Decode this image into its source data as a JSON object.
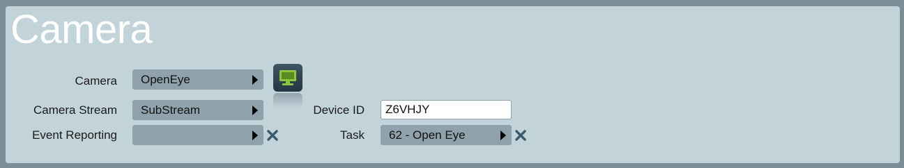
{
  "page": {
    "title": "Camera"
  },
  "form": {
    "camera": {
      "label": "Camera",
      "value": "OpenEye"
    },
    "camera_stream": {
      "label": "Camera Stream",
      "value": "SubStream"
    },
    "event_reporting": {
      "label": "Event Reporting",
      "value": ""
    },
    "device_id": {
      "label": "Device ID",
      "value": "Z6VHJY"
    },
    "task": {
      "label": "Task",
      "value": "62 - Open Eye"
    }
  },
  "icons": {
    "monitor": "monitor-icon",
    "clear": "close-icon",
    "dropdown": "triangle-right-icon"
  },
  "colors": {
    "background": "#7c8e98",
    "panel": "#c3d3da",
    "select": "#8fa2ab",
    "clear_x": "#3d5a6c",
    "monitor_screen": "#8cc63f"
  }
}
